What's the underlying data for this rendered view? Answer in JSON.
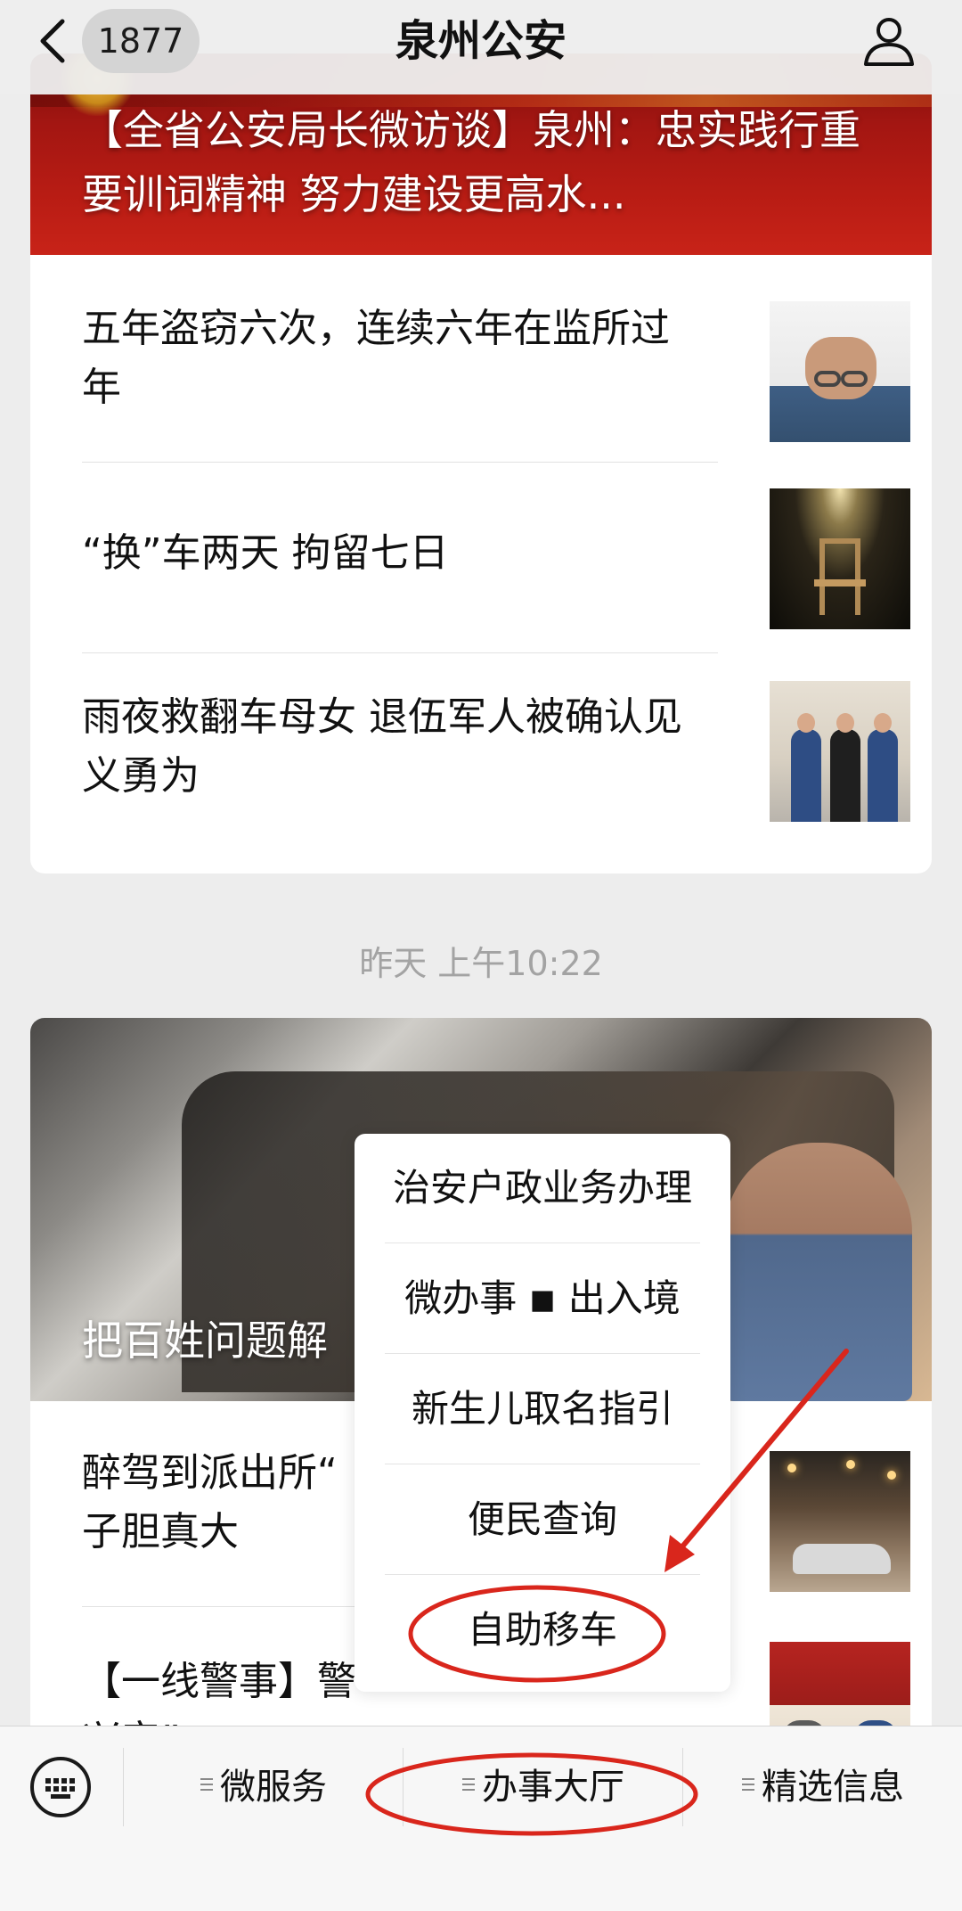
{
  "nav": {
    "back_icon": "chevron-left-icon",
    "unread_count": "1877",
    "title": "泉州公安",
    "profile_icon": "person-icon"
  },
  "feed": [
    {
      "banner_title": "【全省公安局长微访谈】泉州：忠实践行重要训词精神  努力建设更高水...",
      "items": [
        {
          "title": "五年盗窃六次，连续六年在监所过年",
          "thumb": "handcuffs-photo"
        },
        {
          "title": "“换”车两天 拘留七日",
          "thumb": "chair-photo"
        },
        {
          "title": "雨夜救翻车母女 退伍军人被确认见义勇为",
          "thumb": "award-photo"
        }
      ]
    },
    {
      "timestamp": "昨天 上午10:22",
      "banner_title": "把百姓问题解",
      "items": [
        {
          "title": "醉驾到派出所“",
          "title_line2": "子胆真大",
          "thumb": "night-street-photo"
        },
        {
          "title": "【一线警事】警",
          "title_line2": "兴安”",
          "thumb": "police-photo"
        }
      ]
    }
  ],
  "popup_menu": {
    "items": [
      "治安户政业务办理",
      "微办事 ◾ 出入境",
      "新生儿取名指引",
      "便民查询",
      "自助移车"
    ],
    "highlighted": "自助移车"
  },
  "bottom_bar": {
    "keyboard_icon": "keyboard-icon",
    "tabs": [
      "微服务",
      "办事大厅",
      "精选信息"
    ],
    "highlighted_tab": "办事大厅"
  },
  "colors": {
    "annotation_red": "#d9261c",
    "background": "#ededed",
    "banner_red": "#b81c14"
  }
}
